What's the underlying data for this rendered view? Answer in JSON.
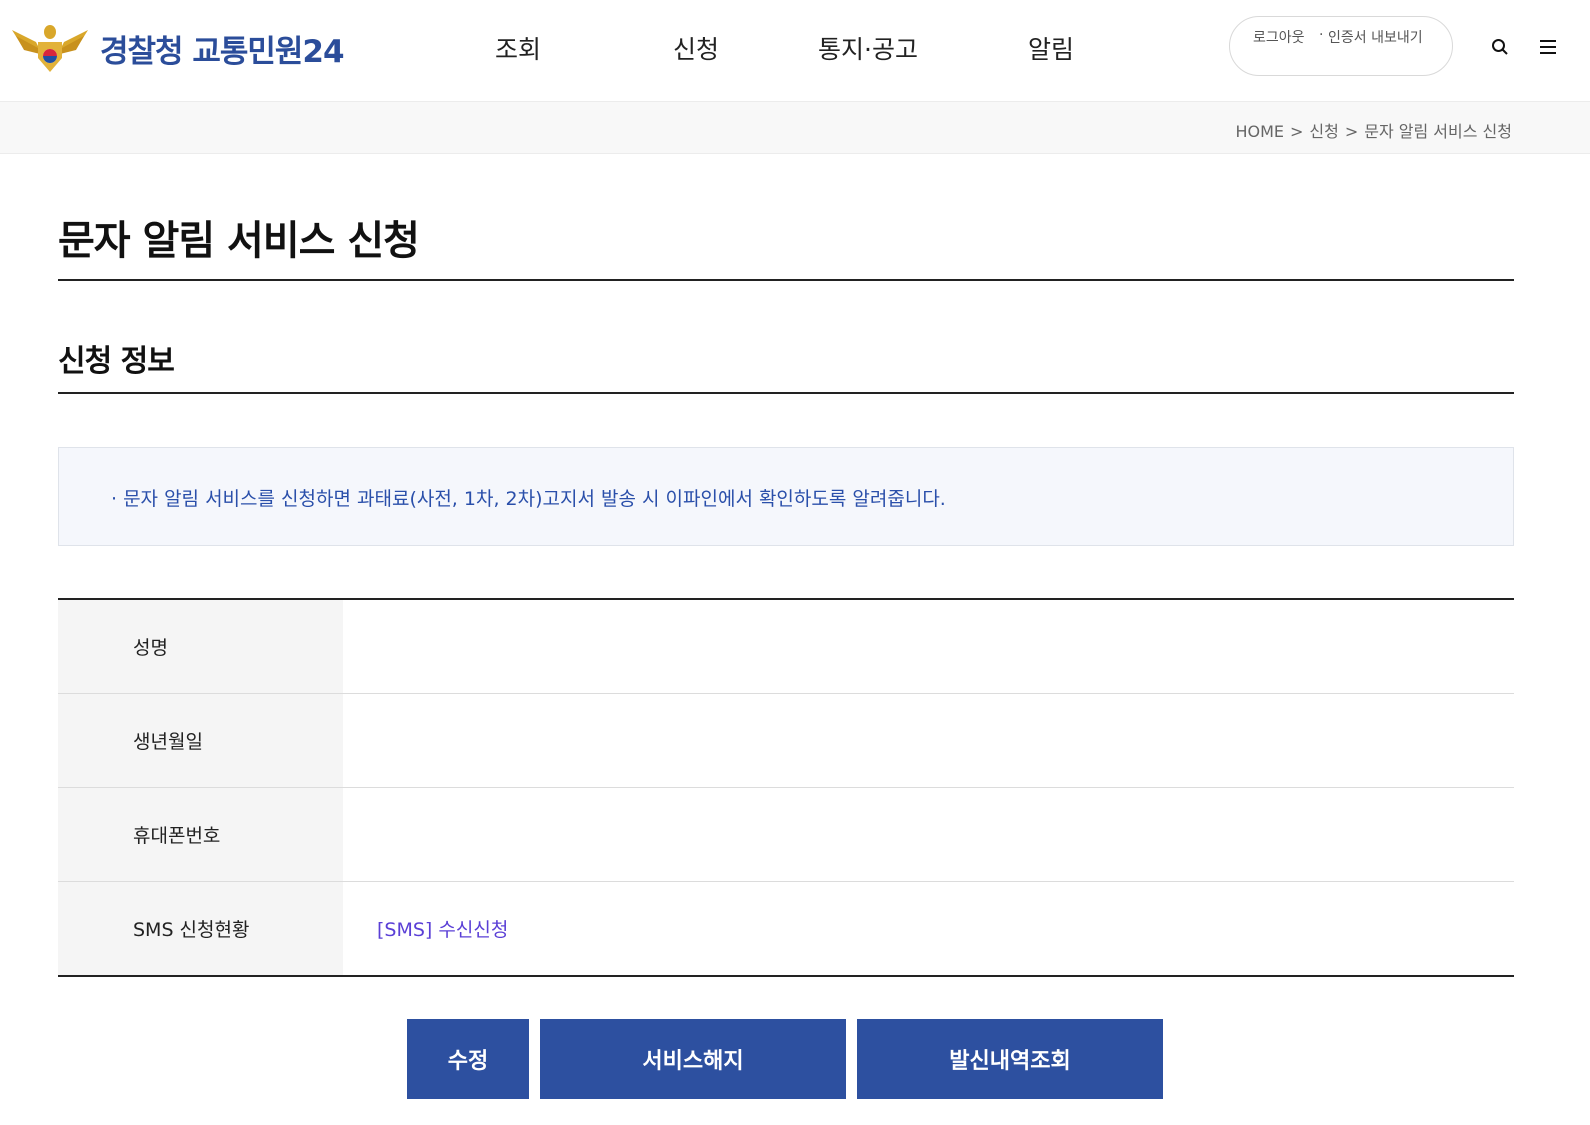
{
  "header": {
    "logo_text": "경찰청 교통민원24",
    "nav": [
      {
        "label": "조회"
      },
      {
        "label": "신청"
      },
      {
        "label": "통지·공고"
      },
      {
        "label": "알림"
      }
    ],
    "util": {
      "logout": "로그아웃",
      "separator": "·",
      "cert_export": "인증서 내보내기"
    },
    "icons": {
      "search": "search-icon",
      "menu": "hamburger-menu-icon"
    }
  },
  "breadcrumb": {
    "items": [
      "HOME",
      "신청",
      "문자 알림 서비스 신청"
    ],
    "separator": ">"
  },
  "page": {
    "title": "문자 알림 서비스 신청",
    "section_title": "신청 정보",
    "notice": "· 문자 알림 서비스를 신청하면 과태료(사전, 1차, 2차)고지서 발송 시 이파인에서 확인하도록 알려줍니다."
  },
  "info_table": {
    "rows": [
      {
        "label": "성명",
        "value": ""
      },
      {
        "label": "생년월일",
        "value": ""
      },
      {
        "label": "휴대폰번호",
        "value": ""
      },
      {
        "label": "SMS 신청현황",
        "value": "[SMS] 수신신청"
      }
    ]
  },
  "buttons": {
    "edit": "수정",
    "cancel_service": "서비스해지",
    "history": "발신내역조회"
  },
  "colors": {
    "brand": "#2b4d9a",
    "button": "#2d50a0",
    "notice_text": "#2a4faa",
    "sms_status": "#5a3fd6"
  }
}
